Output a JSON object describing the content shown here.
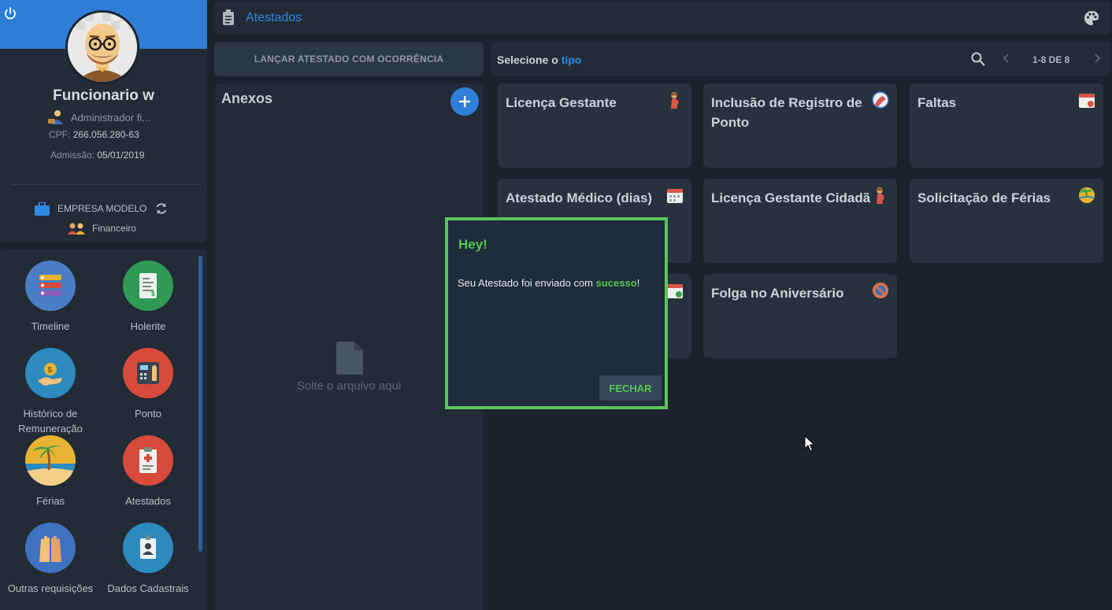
{
  "profile": {
    "name": "Funcionario w",
    "role": "Administrador fi...",
    "cpf_label": "CPF:",
    "cpf": "266.056.280-63",
    "admission_label": "Admissão:",
    "admission": "05/01/2019",
    "company": "EMPRESA MODELO",
    "department": "Financeiro"
  },
  "apps": [
    {
      "label": "Timeline",
      "color": "#4a7fc6",
      "icon": "timeline-icon"
    },
    {
      "label": "Holerite",
      "color": "#2f9a55",
      "icon": "holerite-icon"
    },
    {
      "label": "Histórico de Remuneração",
      "color": "#2d8bc0",
      "icon": "money-hand-icon"
    },
    {
      "label": "Ponto",
      "color": "#d84a3a",
      "icon": "time-clock-icon"
    },
    {
      "label": "Férias",
      "color": "#e8b330",
      "icon": "beach-icon"
    },
    {
      "label": "Atestados",
      "color": "#d84a3a",
      "icon": "clipboard-medical-icon"
    },
    {
      "label": "Outras requisições",
      "color": "#3f73c2",
      "icon": "raised-hands-icon"
    },
    {
      "label": "Dados Cadastrais",
      "color": "#2d8bc0",
      "icon": "id-badge-icon"
    }
  ],
  "header": {
    "title": "Atestados"
  },
  "left": {
    "launch_button": "LANÇAR ATESTADO COM OCORRÊNCIA",
    "attachments_title": "Anexos",
    "add_button": "+",
    "drop_text": "Solte o arquivo aqui"
  },
  "filter": {
    "label_prefix": "Selecione o",
    "label_highlight": "tipo",
    "pagination": "1-8 DE 8"
  },
  "types": [
    {
      "label": "Licença Gestante",
      "icon": "pregnant-woman-icon"
    },
    {
      "label": "Inclusão de Registro de Ponto",
      "icon": "clock-register-icon"
    },
    {
      "label": "Faltas",
      "icon": "calendar-absence-icon"
    },
    {
      "label": "Atestado Médico (dias)",
      "icon": "calendar-days-icon"
    },
    {
      "label": "Licença Gestante Cidadã",
      "icon": "pregnant-woman-icon"
    },
    {
      "label": "Solicitação de Férias",
      "icon": "vacation-icon"
    },
    {
      "label": "",
      "icon": "calendar-check-icon"
    },
    {
      "label": "Folga no Aniversário",
      "icon": "no-work-icon"
    }
  ],
  "modal": {
    "title": "Hey!",
    "message_prefix": "Seu Atestado foi enviado com",
    "message_highlight": "sucesso",
    "message_suffix": "!",
    "close_button": "FECHAR"
  },
  "colors": {
    "accent": "#2f7ed8",
    "success": "#56c64f",
    "background": "#1a222c",
    "panel": "#222b36",
    "card": "#28323e"
  }
}
